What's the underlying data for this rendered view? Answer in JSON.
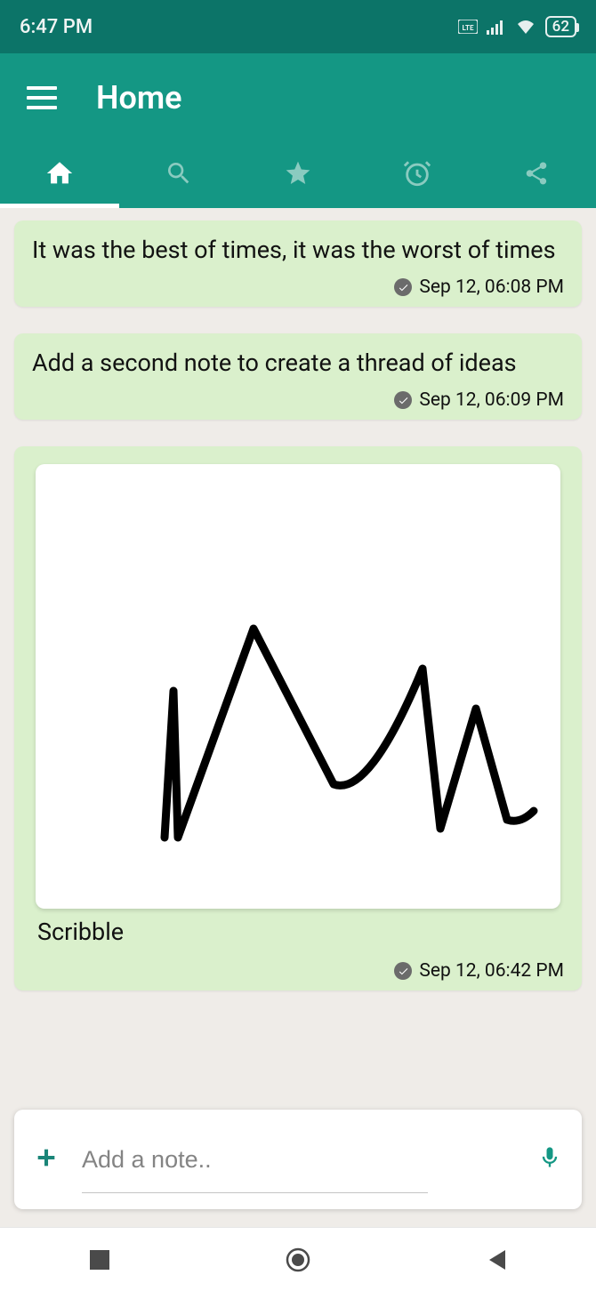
{
  "status": {
    "time": "6:47 PM",
    "battery": "62"
  },
  "appbar": {
    "title": "Home"
  },
  "tabs": {
    "items": [
      {
        "name": "home",
        "active": true
      },
      {
        "name": "search",
        "active": false
      },
      {
        "name": "star",
        "active": false
      },
      {
        "name": "alarm",
        "active": false
      },
      {
        "name": "share",
        "active": false
      }
    ]
  },
  "notes": [
    {
      "text": "It was the best of times, it was the worst of times",
      "timestamp": "Sep 12, 06:08 PM"
    },
    {
      "text": "Add a second note to create a thread of ideas",
      "timestamp": "Sep 12, 06:09 PM"
    },
    {
      "label": "Scribble",
      "timestamp": "Sep 12, 06:42 PM",
      "type": "drawing"
    }
  ],
  "input": {
    "placeholder": "Add a note.."
  }
}
